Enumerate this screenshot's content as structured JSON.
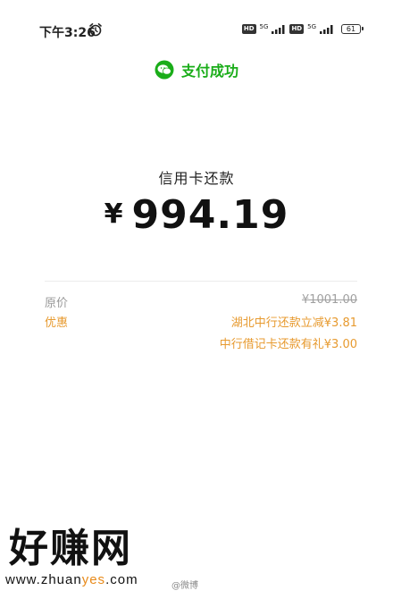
{
  "status_bar": {
    "time": "下午3:26",
    "hd_label": "HD",
    "network_label": "5G",
    "battery": "61"
  },
  "header": {
    "status_text": "支付成功",
    "icon": "wechat-pay-icon",
    "accent_color": "#1aad19"
  },
  "payment": {
    "title": "信用卡还款",
    "currency_symbol": "¥",
    "amount": "994.19"
  },
  "details": {
    "original_label": "原价",
    "original_value": "¥1001.00",
    "discount_label": "优惠",
    "discount_items": [
      "湖北中行还款立减¥3.81",
      "中行借记卡还款有礼¥3.00"
    ],
    "discount_color": "#e79a2f"
  },
  "watermark": {
    "logo": "好赚网",
    "url_prefix": "www.zhuan",
    "url_highlight": "yes",
    "url_suffix": ".com",
    "weibo": "@微博"
  }
}
